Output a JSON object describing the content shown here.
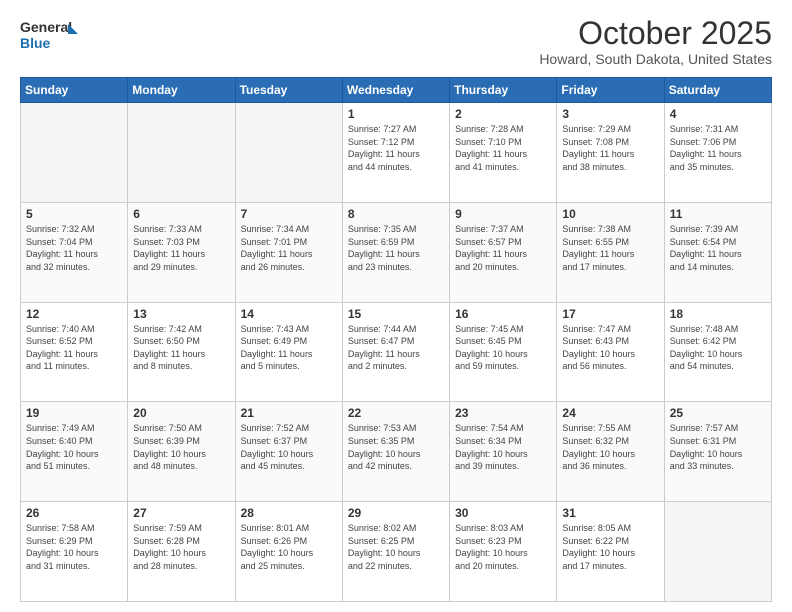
{
  "header": {
    "logo_line1": "General",
    "logo_line2": "Blue",
    "month": "October 2025",
    "location": "Howard, South Dakota, United States"
  },
  "weekdays": [
    "Sunday",
    "Monday",
    "Tuesday",
    "Wednesday",
    "Thursday",
    "Friday",
    "Saturday"
  ],
  "weeks": [
    [
      {
        "day": "",
        "info": ""
      },
      {
        "day": "",
        "info": ""
      },
      {
        "day": "",
        "info": ""
      },
      {
        "day": "1",
        "info": "Sunrise: 7:27 AM\nSunset: 7:12 PM\nDaylight: 11 hours\nand 44 minutes."
      },
      {
        "day": "2",
        "info": "Sunrise: 7:28 AM\nSunset: 7:10 PM\nDaylight: 11 hours\nand 41 minutes."
      },
      {
        "day": "3",
        "info": "Sunrise: 7:29 AM\nSunset: 7:08 PM\nDaylight: 11 hours\nand 38 minutes."
      },
      {
        "day": "4",
        "info": "Sunrise: 7:31 AM\nSunset: 7:06 PM\nDaylight: 11 hours\nand 35 minutes."
      }
    ],
    [
      {
        "day": "5",
        "info": "Sunrise: 7:32 AM\nSunset: 7:04 PM\nDaylight: 11 hours\nand 32 minutes."
      },
      {
        "day": "6",
        "info": "Sunrise: 7:33 AM\nSunset: 7:03 PM\nDaylight: 11 hours\nand 29 minutes."
      },
      {
        "day": "7",
        "info": "Sunrise: 7:34 AM\nSunset: 7:01 PM\nDaylight: 11 hours\nand 26 minutes."
      },
      {
        "day": "8",
        "info": "Sunrise: 7:35 AM\nSunset: 6:59 PM\nDaylight: 11 hours\nand 23 minutes."
      },
      {
        "day": "9",
        "info": "Sunrise: 7:37 AM\nSunset: 6:57 PM\nDaylight: 11 hours\nand 20 minutes."
      },
      {
        "day": "10",
        "info": "Sunrise: 7:38 AM\nSunset: 6:55 PM\nDaylight: 11 hours\nand 17 minutes."
      },
      {
        "day": "11",
        "info": "Sunrise: 7:39 AM\nSunset: 6:54 PM\nDaylight: 11 hours\nand 14 minutes."
      }
    ],
    [
      {
        "day": "12",
        "info": "Sunrise: 7:40 AM\nSunset: 6:52 PM\nDaylight: 11 hours\nand 11 minutes."
      },
      {
        "day": "13",
        "info": "Sunrise: 7:42 AM\nSunset: 6:50 PM\nDaylight: 11 hours\nand 8 minutes."
      },
      {
        "day": "14",
        "info": "Sunrise: 7:43 AM\nSunset: 6:49 PM\nDaylight: 11 hours\nand 5 minutes."
      },
      {
        "day": "15",
        "info": "Sunrise: 7:44 AM\nSunset: 6:47 PM\nDaylight: 11 hours\nand 2 minutes."
      },
      {
        "day": "16",
        "info": "Sunrise: 7:45 AM\nSunset: 6:45 PM\nDaylight: 10 hours\nand 59 minutes."
      },
      {
        "day": "17",
        "info": "Sunrise: 7:47 AM\nSunset: 6:43 PM\nDaylight: 10 hours\nand 56 minutes."
      },
      {
        "day": "18",
        "info": "Sunrise: 7:48 AM\nSunset: 6:42 PM\nDaylight: 10 hours\nand 54 minutes."
      }
    ],
    [
      {
        "day": "19",
        "info": "Sunrise: 7:49 AM\nSunset: 6:40 PM\nDaylight: 10 hours\nand 51 minutes."
      },
      {
        "day": "20",
        "info": "Sunrise: 7:50 AM\nSunset: 6:39 PM\nDaylight: 10 hours\nand 48 minutes."
      },
      {
        "day": "21",
        "info": "Sunrise: 7:52 AM\nSunset: 6:37 PM\nDaylight: 10 hours\nand 45 minutes."
      },
      {
        "day": "22",
        "info": "Sunrise: 7:53 AM\nSunset: 6:35 PM\nDaylight: 10 hours\nand 42 minutes."
      },
      {
        "day": "23",
        "info": "Sunrise: 7:54 AM\nSunset: 6:34 PM\nDaylight: 10 hours\nand 39 minutes."
      },
      {
        "day": "24",
        "info": "Sunrise: 7:55 AM\nSunset: 6:32 PM\nDaylight: 10 hours\nand 36 minutes."
      },
      {
        "day": "25",
        "info": "Sunrise: 7:57 AM\nSunset: 6:31 PM\nDaylight: 10 hours\nand 33 minutes."
      }
    ],
    [
      {
        "day": "26",
        "info": "Sunrise: 7:58 AM\nSunset: 6:29 PM\nDaylight: 10 hours\nand 31 minutes."
      },
      {
        "day": "27",
        "info": "Sunrise: 7:59 AM\nSunset: 6:28 PM\nDaylight: 10 hours\nand 28 minutes."
      },
      {
        "day": "28",
        "info": "Sunrise: 8:01 AM\nSunset: 6:26 PM\nDaylight: 10 hours\nand 25 minutes."
      },
      {
        "day": "29",
        "info": "Sunrise: 8:02 AM\nSunset: 6:25 PM\nDaylight: 10 hours\nand 22 minutes."
      },
      {
        "day": "30",
        "info": "Sunrise: 8:03 AM\nSunset: 6:23 PM\nDaylight: 10 hours\nand 20 minutes."
      },
      {
        "day": "31",
        "info": "Sunrise: 8:05 AM\nSunset: 6:22 PM\nDaylight: 10 hours\nand 17 minutes."
      },
      {
        "day": "",
        "info": ""
      }
    ]
  ]
}
